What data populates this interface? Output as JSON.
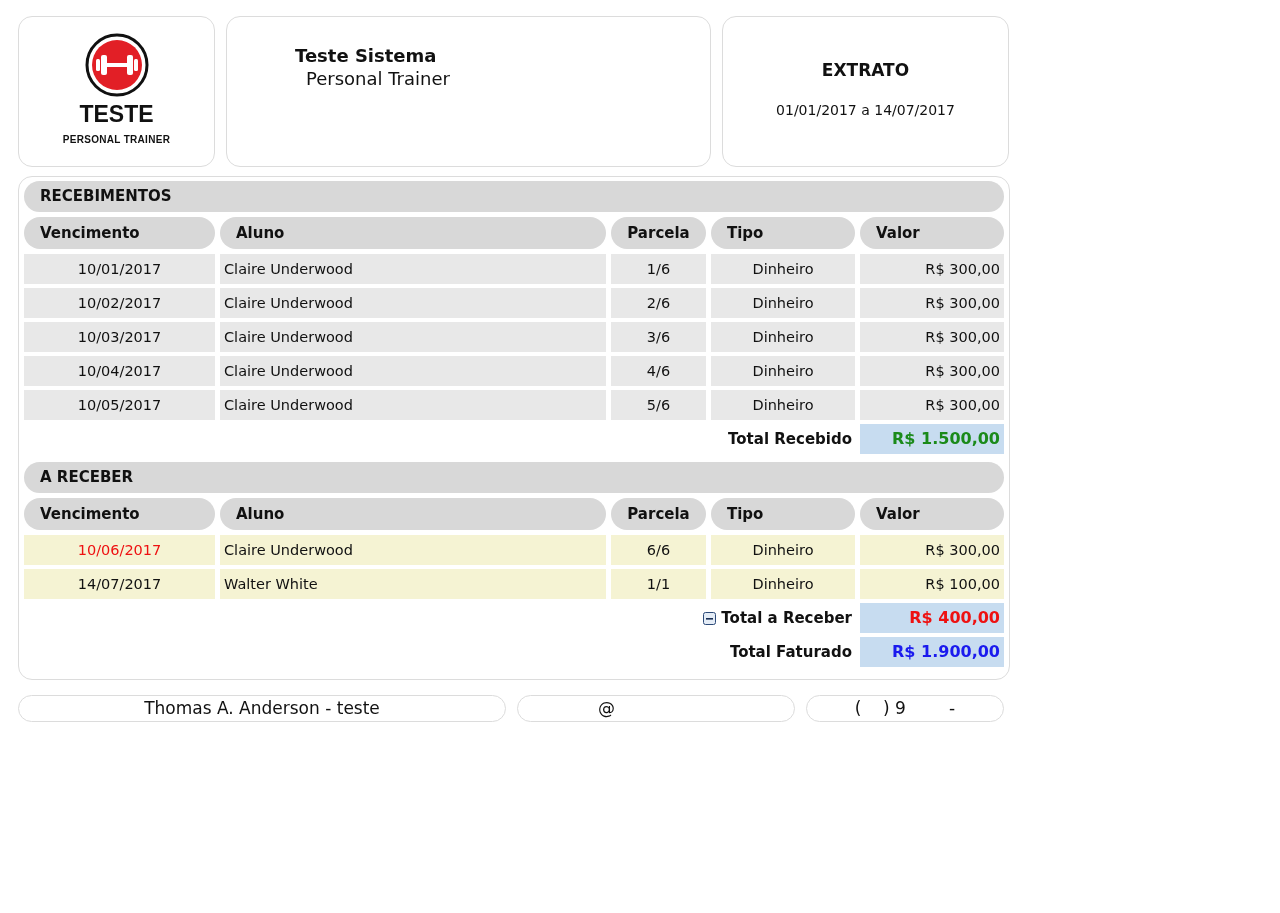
{
  "logo": {
    "name": "TESTE",
    "tagline": "PERSONAL TRAINER"
  },
  "company": {
    "name": "Teste Sistema",
    "subtitle": "Personal Trainer"
  },
  "report": {
    "title": "EXTRATO",
    "period": "01/01/2017 a 14/07/2017"
  },
  "sections": [
    {
      "kind": "received",
      "title": "RECEBIMENTOS",
      "columns": [
        "Vencimento",
        "Aluno",
        "Parcela",
        "Tipo",
        "Valor"
      ],
      "rows": [
        {
          "due": "10/01/2017",
          "student": "Claire Underwood",
          "installment": "1/6",
          "type": "Dinheiro",
          "value": "R$ 300,00",
          "overdue": false
        },
        {
          "due": "10/02/2017",
          "student": "Claire Underwood",
          "installment": "2/6",
          "type": "Dinheiro",
          "value": "R$ 300,00",
          "overdue": false
        },
        {
          "due": "10/03/2017",
          "student": "Claire Underwood",
          "installment": "3/6",
          "type": "Dinheiro",
          "value": "R$ 300,00",
          "overdue": false
        },
        {
          "due": "10/04/2017",
          "student": "Claire Underwood",
          "installment": "4/6",
          "type": "Dinheiro",
          "value": "R$ 300,00",
          "overdue": false
        },
        {
          "due": "10/05/2017",
          "student": "Claire Underwood",
          "installment": "5/6",
          "type": "Dinheiro",
          "value": "R$ 300,00",
          "overdue": false
        }
      ],
      "totals": [
        {
          "label": "Total Recebido",
          "value": "R$ 1.500,00",
          "color": "#1a8a1a"
        }
      ]
    },
    {
      "kind": "pending",
      "title": "A RECEBER",
      "columns": [
        "Vencimento",
        "Aluno",
        "Parcela",
        "Tipo",
        "Valor"
      ],
      "rows": [
        {
          "due": "10/06/2017",
          "student": "Claire Underwood",
          "installment": "6/6",
          "type": "Dinheiro",
          "value": "R$ 300,00",
          "overdue": true
        },
        {
          "due": "14/07/2017",
          "student": "Walter White",
          "installment": "1/1",
          "type": "Dinheiro",
          "value": "R$ 100,00",
          "overdue": false
        }
      ],
      "totals": [
        {
          "label": "Total a Receber",
          "value": "R$ 400,00",
          "color": "#ee1111",
          "expanded": true
        },
        {
          "label": "Total Faturado",
          "value": "R$ 1.900,00",
          "color": "#1a1aee"
        }
      ]
    }
  ],
  "footer": [
    "Thomas A. Anderson - teste",
    "@",
    "(    ) 9        -"
  ]
}
